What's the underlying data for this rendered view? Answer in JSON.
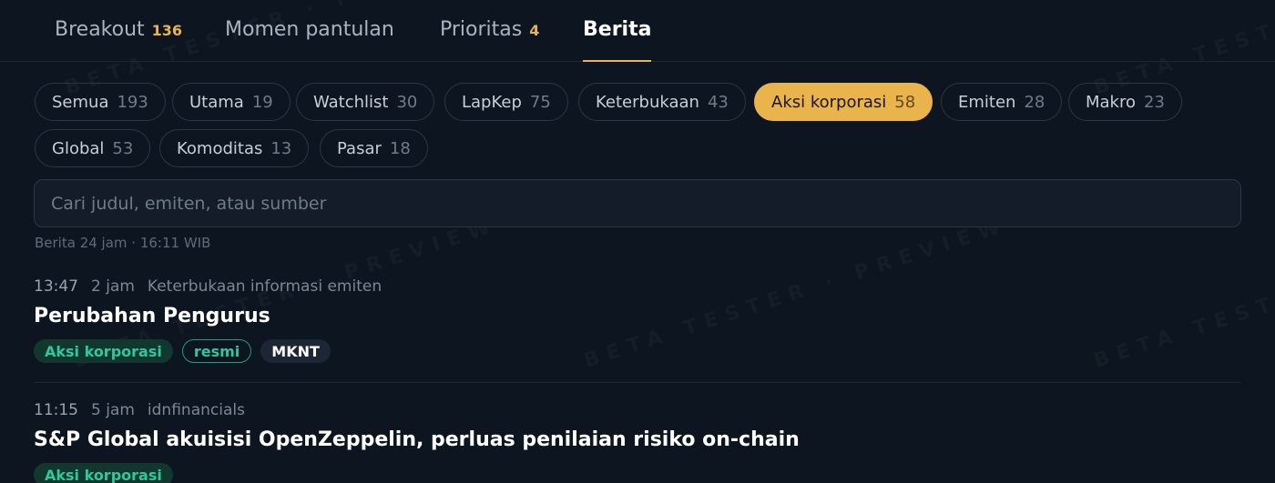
{
  "watermark": "BETA TESTER · PREVIEW",
  "tabs": [
    {
      "label": "Breakout",
      "count": "136"
    },
    {
      "label": "Momen pantulan",
      "count": ""
    },
    {
      "label": "Prioritas",
      "count": "4"
    },
    {
      "label": "Berita",
      "count": "",
      "active": true
    }
  ],
  "filters": [
    {
      "label": "Semua",
      "count": "193"
    },
    {
      "label": "Utama",
      "count": "19"
    },
    {
      "label": "Watchlist",
      "count": "30"
    },
    {
      "label": "LapKep",
      "count": "75"
    },
    {
      "label": "Keterbukaan",
      "count": "43"
    },
    {
      "label": "Aksi korporasi",
      "count": "58",
      "active": true
    },
    {
      "label": "Emiten",
      "count": "28"
    },
    {
      "label": "Makro",
      "count": "23"
    },
    {
      "label": "Global",
      "count": "53"
    },
    {
      "label": "Komoditas",
      "count": "13"
    },
    {
      "label": "Pasar",
      "count": "18"
    }
  ],
  "search": {
    "placeholder": "Cari judul, emiten, atau sumber"
  },
  "summary": "Berita 24 jam · 16:11 WIB",
  "news": [
    {
      "time": "13:47",
      "ago": "2 jam",
      "source": "Keterbukaan informasi emiten",
      "title": "Perubahan Pengurus",
      "tags": [
        {
          "label": "Aksi korporasi",
          "kind": "cat"
        },
        {
          "label": "resmi",
          "kind": "official"
        },
        {
          "label": "MKNT",
          "kind": "ticker"
        }
      ]
    },
    {
      "time": "11:15",
      "ago": "5 jam",
      "source": "idnfinancials",
      "title": "S&P Global akuisisi OpenZeppelin, perluas penilaian risiko on-chain",
      "tags": [
        {
          "label": "Aksi korporasi",
          "kind": "cat"
        }
      ]
    }
  ],
  "colors": {
    "accent": "#e9b44c",
    "background": "#0d1520",
    "tag_green": "#2fc79b"
  }
}
